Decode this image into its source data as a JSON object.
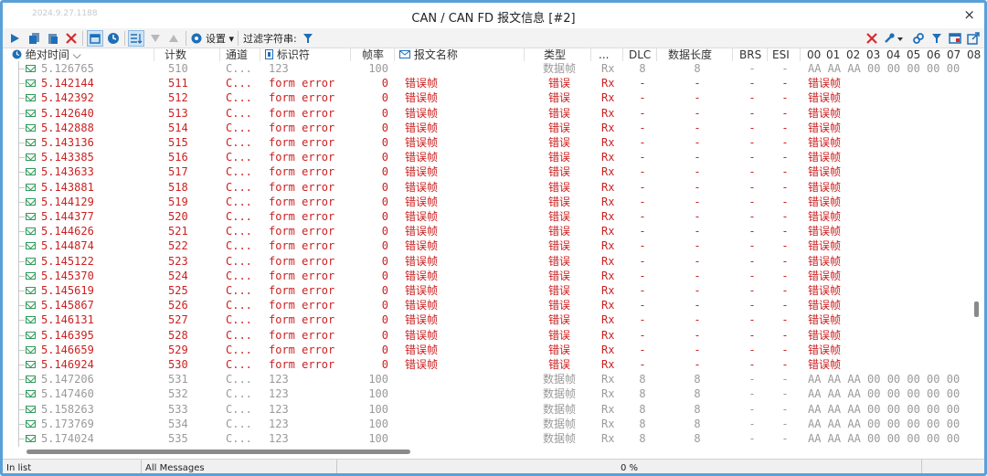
{
  "window": {
    "stamp": "2024.9.27.1188",
    "title": "CAN / CAN FD 报文信息 [#2]",
    "close_glyph": "×"
  },
  "toolbar": {
    "settings_label": "设置",
    "filter_label": "过滤字符串:",
    "icons": [
      "play-icon",
      "copy-icon",
      "paste-icon",
      "delete-icon",
      "calendar-icon",
      "clock-icon",
      "list-icon",
      "down-arrow-icon",
      "up-arrow-icon",
      "gear-icon",
      "filter-icon",
      "clear-filter-icon",
      "wrench-icon",
      "link-icon",
      "funnel-icon",
      "window-icon",
      "export-icon"
    ]
  },
  "columns": {
    "time": "绝对时间",
    "count": "计数",
    "channel": "通道",
    "id": "标识符",
    "rate": "帧率",
    "name": "报文名称",
    "type": "类型",
    "dir": "...",
    "dlc": "DLC",
    "len": "数据长度",
    "brs": "BRS",
    "esi": "ESI",
    "bytes": [
      "00",
      "01",
      "02",
      "03",
      "04",
      "05",
      "06",
      "07",
      "08"
    ]
  },
  "rows": [
    {
      "time": "5.126765",
      "count": "510",
      "ch": "C...",
      "id": "123",
      "rate": "100",
      "name": "",
      "type": "数据帧",
      "dir": "Rx",
      "dlc": "8",
      "len": "8",
      "brs": "-",
      "esi": "-",
      "data": "AA AA AA 00 00 00 00 00",
      "kind": "gray"
    },
    {
      "time": "5.142144",
      "count": "511",
      "ch": "C...",
      "id": "form error",
      "rate": "0",
      "name": "错误帧",
      "type": "错误",
      "dir": "Rx",
      "dlc": "-",
      "len": "-",
      "brs": "-",
      "esi": "-",
      "data": "错误帧",
      "kind": "red"
    },
    {
      "time": "5.142392",
      "count": "512",
      "ch": "C...",
      "id": "form error",
      "rate": "0",
      "name": "错误帧",
      "type": "错误",
      "dir": "Rx",
      "dlc": "-",
      "len": "-",
      "brs": "-",
      "esi": "-",
      "data": "错误帧",
      "kind": "red"
    },
    {
      "time": "5.142640",
      "count": "513",
      "ch": "C...",
      "id": "form error",
      "rate": "0",
      "name": "错误帧",
      "type": "错误",
      "dir": "Rx",
      "dlc": "-",
      "len": "-",
      "brs": "-",
      "esi": "-",
      "data": "错误帧",
      "kind": "red"
    },
    {
      "time": "5.142888",
      "count": "514",
      "ch": "C...",
      "id": "form error",
      "rate": "0",
      "name": "错误帧",
      "type": "错误",
      "dir": "Rx",
      "dlc": "-",
      "len": "-",
      "brs": "-",
      "esi": "-",
      "data": "错误帧",
      "kind": "red"
    },
    {
      "time": "5.143136",
      "count": "515",
      "ch": "C...",
      "id": "form error",
      "rate": "0",
      "name": "错误帧",
      "type": "错误",
      "dir": "Rx",
      "dlc": "-",
      "len": "-",
      "brs": "-",
      "esi": "-",
      "data": "错误帧",
      "kind": "red"
    },
    {
      "time": "5.143385",
      "count": "516",
      "ch": "C...",
      "id": "form error",
      "rate": "0",
      "name": "错误帧",
      "type": "错误",
      "dir": "Rx",
      "dlc": "-",
      "len": "-",
      "brs": "-",
      "esi": "-",
      "data": "错误帧",
      "kind": "red"
    },
    {
      "time": "5.143633",
      "count": "517",
      "ch": "C...",
      "id": "form error",
      "rate": "0",
      "name": "错误帧",
      "type": "错误",
      "dir": "Rx",
      "dlc": "-",
      "len": "-",
      "brs": "-",
      "esi": "-",
      "data": "错误帧",
      "kind": "red"
    },
    {
      "time": "5.143881",
      "count": "518",
      "ch": "C...",
      "id": "form error",
      "rate": "0",
      "name": "错误帧",
      "type": "错误",
      "dir": "Rx",
      "dlc": "-",
      "len": "-",
      "brs": "-",
      "esi": "-",
      "data": "错误帧",
      "kind": "red"
    },
    {
      "time": "5.144129",
      "count": "519",
      "ch": "C...",
      "id": "form error",
      "rate": "0",
      "name": "错误帧",
      "type": "错误",
      "dir": "Rx",
      "dlc": "-",
      "len": "-",
      "brs": "-",
      "esi": "-",
      "data": "错误帧",
      "kind": "red"
    },
    {
      "time": "5.144377",
      "count": "520",
      "ch": "C...",
      "id": "form error",
      "rate": "0",
      "name": "错误帧",
      "type": "错误",
      "dir": "Rx",
      "dlc": "-",
      "len": "-",
      "brs": "-",
      "esi": "-",
      "data": "错误帧",
      "kind": "red"
    },
    {
      "time": "5.144626",
      "count": "521",
      "ch": "C...",
      "id": "form error",
      "rate": "0",
      "name": "错误帧",
      "type": "错误",
      "dir": "Rx",
      "dlc": "-",
      "len": "-",
      "brs": "-",
      "esi": "-",
      "data": "错误帧",
      "kind": "red"
    },
    {
      "time": "5.144874",
      "count": "522",
      "ch": "C...",
      "id": "form error",
      "rate": "0",
      "name": "错误帧",
      "type": "错误",
      "dir": "Rx",
      "dlc": "-",
      "len": "-",
      "brs": "-",
      "esi": "-",
      "data": "错误帧",
      "kind": "red"
    },
    {
      "time": "5.145122",
      "count": "523",
      "ch": "C...",
      "id": "form error",
      "rate": "0",
      "name": "错误帧",
      "type": "错误",
      "dir": "Rx",
      "dlc": "-",
      "len": "-",
      "brs": "-",
      "esi": "-",
      "data": "错误帧",
      "kind": "red"
    },
    {
      "time": "5.145370",
      "count": "524",
      "ch": "C...",
      "id": "form error",
      "rate": "0",
      "name": "错误帧",
      "type": "错误",
      "dir": "Rx",
      "dlc": "-",
      "len": "-",
      "brs": "-",
      "esi": "-",
      "data": "错误帧",
      "kind": "red"
    },
    {
      "time": "5.145619",
      "count": "525",
      "ch": "C...",
      "id": "form error",
      "rate": "0",
      "name": "错误帧",
      "type": "错误",
      "dir": "Rx",
      "dlc": "-",
      "len": "-",
      "brs": "-",
      "esi": "-",
      "data": "错误帧",
      "kind": "red"
    },
    {
      "time": "5.145867",
      "count": "526",
      "ch": "C...",
      "id": "form error",
      "rate": "0",
      "name": "错误帧",
      "type": "错误",
      "dir": "Rx",
      "dlc": "-",
      "len": "-",
      "brs": "-",
      "esi": "-",
      "data": "错误帧",
      "kind": "red"
    },
    {
      "time": "5.146131",
      "count": "527",
      "ch": "C...",
      "id": "form error",
      "rate": "0",
      "name": "错误帧",
      "type": "错误",
      "dir": "Rx",
      "dlc": "-",
      "len": "-",
      "brs": "-",
      "esi": "-",
      "data": "错误帧",
      "kind": "red"
    },
    {
      "time": "5.146395",
      "count": "528",
      "ch": "C...",
      "id": "form error",
      "rate": "0",
      "name": "错误帧",
      "type": "错误",
      "dir": "Rx",
      "dlc": "-",
      "len": "-",
      "brs": "-",
      "esi": "-",
      "data": "错误帧",
      "kind": "red"
    },
    {
      "time": "5.146659",
      "count": "529",
      "ch": "C...",
      "id": "form error",
      "rate": "0",
      "name": "错误帧",
      "type": "错误",
      "dir": "Rx",
      "dlc": "-",
      "len": "-",
      "brs": "-",
      "esi": "-",
      "data": "错误帧",
      "kind": "red"
    },
    {
      "time": "5.146924",
      "count": "530",
      "ch": "C...",
      "id": "form error",
      "rate": "0",
      "name": "错误帧",
      "type": "错误",
      "dir": "Rx",
      "dlc": "-",
      "len": "-",
      "brs": "-",
      "esi": "-",
      "data": "错误帧",
      "kind": "red"
    },
    {
      "time": "5.147206",
      "count": "531",
      "ch": "C...",
      "id": "123",
      "rate": "100",
      "name": "",
      "type": "数据帧",
      "dir": "Rx",
      "dlc": "8",
      "len": "8",
      "brs": "-",
      "esi": "-",
      "data": "AA AA AA 00 00 00 00 00",
      "kind": "gray"
    },
    {
      "time": "5.147460",
      "count": "532",
      "ch": "C...",
      "id": "123",
      "rate": "100",
      "name": "",
      "type": "数据帧",
      "dir": "Rx",
      "dlc": "8",
      "len": "8",
      "brs": "-",
      "esi": "-",
      "data": "AA AA AA 00 00 00 00 00",
      "kind": "gray"
    },
    {
      "time": "5.158263",
      "count": "533",
      "ch": "C...",
      "id": "123",
      "rate": "100",
      "name": "",
      "type": "数据帧",
      "dir": "Rx",
      "dlc": "8",
      "len": "8",
      "brs": "-",
      "esi": "-",
      "data": "AA AA AA 00 00 00 00 00",
      "kind": "gray"
    },
    {
      "time": "5.173769",
      "count": "534",
      "ch": "C...",
      "id": "123",
      "rate": "100",
      "name": "",
      "type": "数据帧",
      "dir": "Rx",
      "dlc": "8",
      "len": "8",
      "brs": "-",
      "esi": "-",
      "data": "AA AA AA 00 00 00 00 00",
      "kind": "gray"
    },
    {
      "time": "5.174024",
      "count": "535",
      "ch": "C...",
      "id": "123",
      "rate": "100",
      "name": "",
      "type": "数据帧",
      "dir": "Rx",
      "dlc": "8",
      "len": "8",
      "brs": "-",
      "esi": "-",
      "data": "AA AA AA 00 00 00 00 00",
      "kind": "gray"
    }
  ],
  "status": {
    "left": "In list",
    "filter": "All Messages",
    "progress": "0 %"
  },
  "colors": {
    "accent": "#5aa0d8",
    "error_text": "#cc1f1f",
    "muted_text": "#9a9a9a",
    "icon_blue": "#1f6fb8",
    "icon_red": "#d62b2b",
    "envelope_green": "#2f9a5a"
  }
}
